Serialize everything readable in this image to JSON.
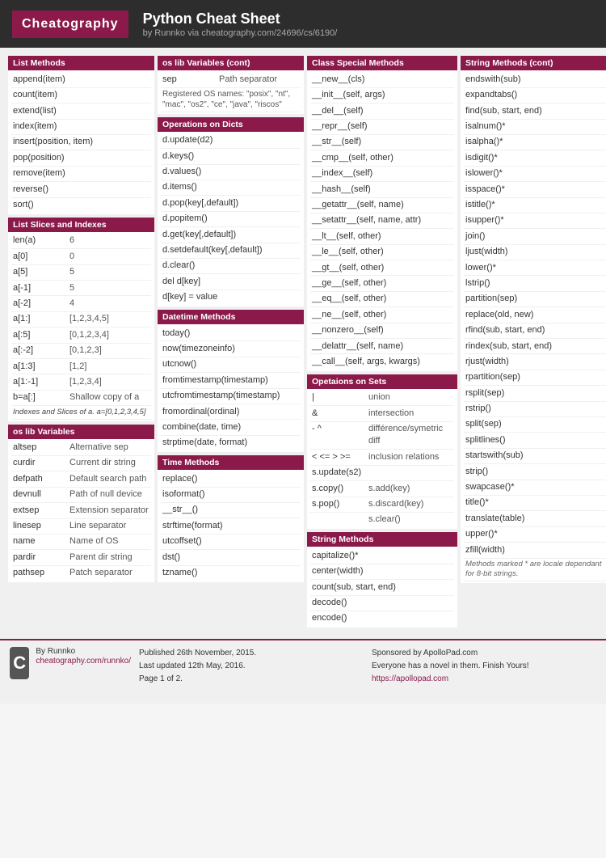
{
  "header": {
    "logo": "Cheatography",
    "title": "Python Cheat Sheet",
    "subtitle": "by Runnko via cheatography.com/24696/cs/6190/"
  },
  "columns": [
    {
      "sections": [
        {
          "id": "list-methods",
          "header": "List Methods",
          "type": "single",
          "rows": [
            "append(item)",
            "count(item)",
            "extend(list)",
            "index(item)",
            "insert(position, item)",
            "pop(position)",
            "remove(item)",
            "reverse()",
            "sort()"
          ]
        },
        {
          "id": "list-slices",
          "header": "List Slices and Indexes",
          "type": "key-val",
          "rows": [
            [
              "len(a)",
              "6"
            ],
            [
              "a[0]",
              "0"
            ],
            [
              "a[5]",
              "5"
            ],
            [
              "a[-1]",
              "5"
            ],
            [
              "a[-2]",
              "4"
            ],
            [
              "a[1:]",
              "[1,2,3,4,5]"
            ],
            [
              "a[:5]",
              "[0,1,2,3,4]"
            ],
            [
              "a[:-2]",
              "[0,1,2,3]"
            ],
            [
              "a[1:3]",
              "[1,2]"
            ],
            [
              "a[1:-1]",
              "[1,2,3,4]"
            ],
            [
              "b=a[:]",
              "Shallow copy of a"
            ]
          ],
          "note": "Indexes and Slices of a.\na=[0,1,2,3,4,5]"
        },
        {
          "id": "os-lib-vars",
          "header": "os lib Variables",
          "type": "key-val",
          "rows": [
            [
              "altsep",
              "Alternative sep"
            ],
            [
              "curdir",
              "Current dir string"
            ],
            [
              "defpath",
              "Default search path"
            ],
            [
              "devnull",
              "Path of null device"
            ],
            [
              "extsep",
              "Extension separator"
            ],
            [
              "linesep",
              "Line separator"
            ],
            [
              "name",
              "Name of OS"
            ],
            [
              "pardir",
              "Parent dir string"
            ],
            [
              "pathsep",
              "Patch separator"
            ]
          ]
        }
      ]
    },
    {
      "sections": [
        {
          "id": "os-lib-vars-cont",
          "header": "os lib Variables (cont)",
          "type": "mixed",
          "rows": [
            {
              "key": "sep",
              "val": "Path separator"
            },
            {
              "type": "note",
              "text": "Registered OS names: \"posix\", \"nt\", \"mac\", \"os2\", \"ce\", \"java\", \"riscos\""
            }
          ]
        },
        {
          "id": "ops-on-dicts",
          "header": "Operations on Dicts",
          "type": "single",
          "rows": [
            "d.update(d2)",
            "d.keys()",
            "d.values()",
            "d.items()",
            "d.pop(key[,default])",
            "d.popitem()",
            "d.get(key[,default])",
            "d.setdefault(key[,default])",
            "d.clear()",
            "del d[key]",
            "d[key] = value"
          ]
        },
        {
          "id": "datetime-methods",
          "header": "Datetime Methods",
          "type": "single",
          "rows": [
            "today()",
            "now(timezoneinfo)",
            "utcnow()",
            "fromtimestamp(timestamp)",
            "utcfromtimestamp(timestamp)",
            "fromordinal(ordinal)",
            "combine(date, time)",
            "strptime(date, format)"
          ]
        },
        {
          "id": "time-methods",
          "header": "Time Methods",
          "type": "single",
          "rows": [
            "replace()",
            "isoformat()",
            "__str__()",
            "strftime(format)",
            "utcoffset()",
            "dst()",
            "tzname()"
          ]
        }
      ]
    },
    {
      "sections": [
        {
          "id": "class-special-methods",
          "header": "Class Special Methods",
          "type": "single",
          "rows": [
            "__new__(cls)",
            "__init__(self, args)",
            "__del__(self)",
            "__repr__(self)",
            "__str__(self)",
            "__cmp__(self, other)",
            "__index__(self)",
            "__hash__(self)",
            "__getattr__(self, name)",
            "__setattr__(self, name, attr)",
            "__lt__(self, other)",
            "__le__(self, other)",
            "__gt__(self, other)",
            "__ge__(self, other)",
            "__eq__(self, other)",
            "__ne__(self, other)",
            "__nonzero__(self)",
            "__delattr__(self, name)",
            "__call__(self, args, kwargs)"
          ]
        },
        {
          "id": "ops-on-sets",
          "header": "Opetaions on Sets",
          "type": "key-val",
          "rows": [
            [
              "|",
              "union"
            ],
            [
              "&",
              "intersection"
            ],
            [
              "- ^",
              "différence/symetric diff"
            ],
            [
              "< <= > >=",
              "inclusion relations"
            ],
            [
              "s.update(s2)",
              ""
            ],
            [
              "s.copy()",
              "s.add(key)"
            ],
            [
              "s.pop()",
              "s.discard(key)"
            ],
            [
              "",
              "s.clear()"
            ]
          ]
        },
        {
          "id": "string-methods",
          "header": "String Methods",
          "type": "single",
          "rows": [
            "capitalize()*",
            "center(width)",
            "count(sub, start, end)",
            "decode()",
            "encode()"
          ]
        }
      ]
    },
    {
      "sections": [
        {
          "id": "string-methods-cont",
          "header": "String Methods (cont)",
          "type": "single",
          "rows": [
            "endswith(sub)",
            "expandtabs()",
            "find(sub, start, end)",
            "isalnum()*",
            "isalpha()*",
            "isdigit()*",
            "islower()*",
            "isspace()*",
            "istitle()*",
            "isupper()*",
            "join()",
            "ljust(width)",
            "lower()*",
            "lstrip()",
            "partition(sep)",
            "replace(old, new)",
            "rfind(sub, start, end)",
            "rindex(sub, start, end)",
            "rjust(width)",
            "rpartition(sep)",
            "rsplit(sep)",
            "rstrip()",
            "split(sep)",
            "splitlines()",
            "startswith(sub)",
            "strip()",
            "swapcase()*",
            "title()*",
            "translate(table)",
            "upper()*",
            "zfill(width)"
          ],
          "note": "Methods marked * are locale dependant for 8-bit strings."
        }
      ]
    }
  ],
  "footer": {
    "logo_letter": "C",
    "author": "By Runnko",
    "author_link": "cheatography.com/runnko/",
    "published": "Published 26th November, 2015.",
    "updated": "Last updated 12th May, 2016.",
    "page": "Page 1 of 2.",
    "sponsor": "Sponsored by ApolloPad.com",
    "sponsor_text": "Everyone has a novel in them. Finish Yours!",
    "sponsor_link": "https://apollopad.com"
  }
}
